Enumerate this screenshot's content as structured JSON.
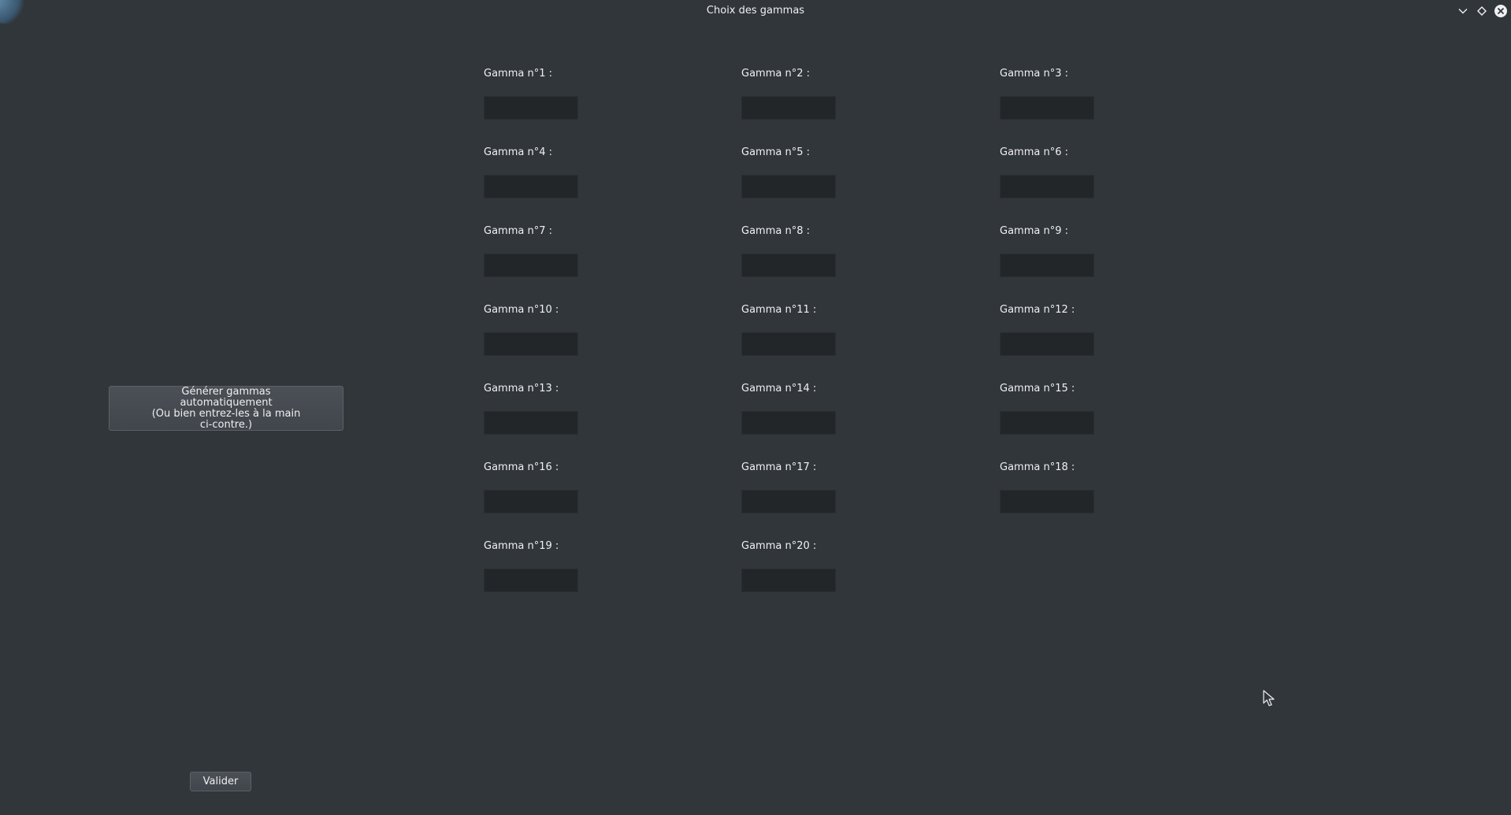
{
  "window": {
    "title": "Choix des gammas",
    "controls": {
      "minimize_icon": "chevron-down-icon",
      "maximize_icon": "diamond-icon",
      "close_icon": "close-circle-icon"
    }
  },
  "generate_button": {
    "lines": [
      "Générer gammas",
      "automatiquement",
      "(Ou bien entrez-les à la main",
      "ci-contre.)"
    ]
  },
  "validate_button": {
    "label": "Valider"
  },
  "gammas": [
    {
      "label": "Gamma n°1 :",
      "value": ""
    },
    {
      "label": "Gamma n°2 :",
      "value": ""
    },
    {
      "label": "Gamma n°3 :",
      "value": ""
    },
    {
      "label": "Gamma n°4 :",
      "value": ""
    },
    {
      "label": "Gamma n°5 :",
      "value": ""
    },
    {
      "label": "Gamma n°6 :",
      "value": ""
    },
    {
      "label": "Gamma n°7 :",
      "value": ""
    },
    {
      "label": "Gamma n°8 :",
      "value": ""
    },
    {
      "label": "Gamma n°9 :",
      "value": ""
    },
    {
      "label": "Gamma n°10 :",
      "value": ""
    },
    {
      "label": "Gamma n°11 :",
      "value": ""
    },
    {
      "label": "Gamma n°12 :",
      "value": ""
    },
    {
      "label": "Gamma n°13 :",
      "value": ""
    },
    {
      "label": "Gamma n°14 :",
      "value": ""
    },
    {
      "label": "Gamma n°15 :",
      "value": ""
    },
    {
      "label": "Gamma n°16 :",
      "value": ""
    },
    {
      "label": "Gamma n°17 :",
      "value": ""
    },
    {
      "label": "Gamma n°18 :",
      "value": ""
    },
    {
      "label": "Gamma n°19 :",
      "value": ""
    },
    {
      "label": "Gamma n°20 :",
      "value": ""
    }
  ],
  "colors": {
    "background": "#31363b",
    "input_background": "#232629",
    "text": "#eff0f1"
  }
}
